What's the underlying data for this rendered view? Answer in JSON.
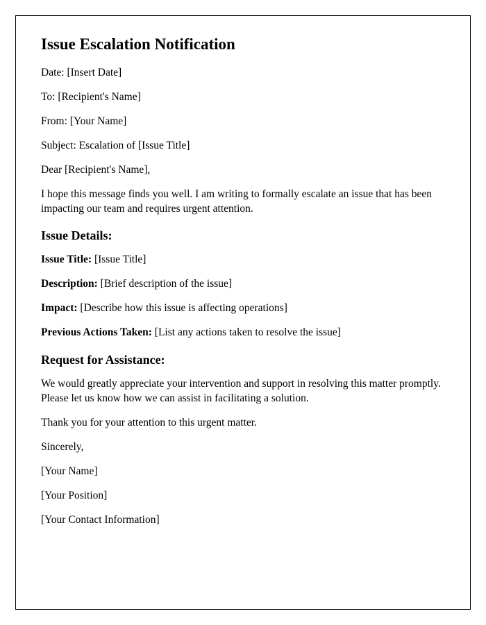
{
  "title": "Issue Escalation Notification",
  "header": {
    "date_label": "Date: ",
    "date_value": "[Insert Date]",
    "to_label": "To: ",
    "to_value": "[Recipient's Name]",
    "from_label": "From: ",
    "from_value": "[Your Name]",
    "subject_label": "Subject: ",
    "subject_value": "Escalation of [Issue Title]"
  },
  "greeting": "Dear [Recipient's Name],",
  "intro": "I hope this message finds you well. I am writing to formally escalate an issue that has been impacting our team and requires urgent attention.",
  "details_heading": "Issue Details:",
  "details": {
    "title_label": "Issue Title: ",
    "title_value": "[Issue Title]",
    "description_label": "Description: ",
    "description_value": "[Brief description of the issue]",
    "impact_label": "Impact: ",
    "impact_value": "[Describe how this issue is affecting operations]",
    "actions_label": "Previous Actions Taken: ",
    "actions_value": "[List any actions taken to resolve the issue]"
  },
  "request_heading": "Request for Assistance:",
  "request_body": "We would greatly appreciate your intervention and support in resolving this matter promptly. Please let us know how we can assist in facilitating a solution.",
  "thanks": "Thank you for your attention to this urgent matter.",
  "signoff": {
    "sincerely": "Sincerely,",
    "name": "[Your Name]",
    "position": "[Your Position]",
    "contact": "[Your Contact Information]"
  }
}
